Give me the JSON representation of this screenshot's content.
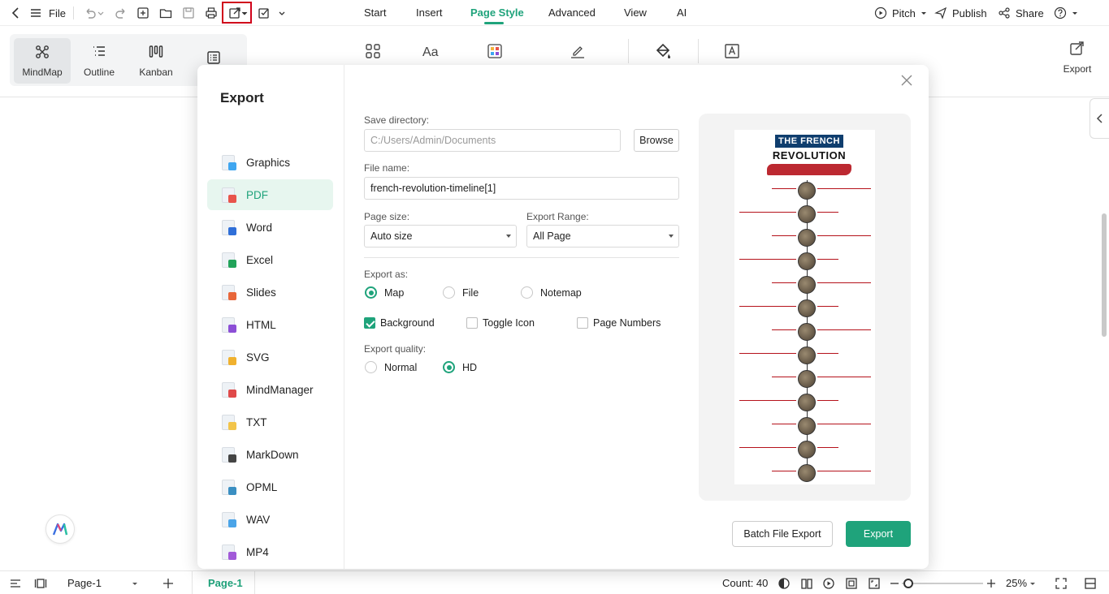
{
  "topbar": {
    "file_label": "File",
    "menu_tabs": [
      "Start",
      "Insert",
      "Page Style",
      "Advanced",
      "View",
      "AI"
    ],
    "active_tab": "Page Style",
    "pitch": "Pitch",
    "publish": "Publish",
    "share": "Share"
  },
  "ribbon": {
    "views": [
      "MindMap",
      "Outline",
      "Kanban"
    ],
    "export_label": "Export"
  },
  "export_dialog": {
    "title": "Export",
    "formats": [
      {
        "label": "Graphics",
        "color": "#3fa6f0"
      },
      {
        "label": "PDF",
        "color": "#e8544b"
      },
      {
        "label": "Word",
        "color": "#2f6fd8"
      },
      {
        "label": "Excel",
        "color": "#22a35a"
      },
      {
        "label": "Slides",
        "color": "#e8663a"
      },
      {
        "label": "HTML",
        "color": "#8c4fd6"
      },
      {
        "label": "SVG",
        "color": "#f0b12e"
      },
      {
        "label": "MindManager",
        "color": "#e04a4a"
      },
      {
        "label": "TXT",
        "color": "#f2c44a"
      },
      {
        "label": "MarkDown",
        "color": "#444444"
      },
      {
        "label": "OPML",
        "color": "#3a8fc2"
      },
      {
        "label": "WAV",
        "color": "#4aa4e8"
      },
      {
        "label": "MP4",
        "color": "#a15ad8"
      }
    ],
    "active_format": "PDF",
    "save_directory_label": "Save directory:",
    "save_directory_placeholder": "C:/Users/Admin/Documents",
    "browse": "Browse",
    "file_name_label": "File name:",
    "file_name": "french-revolution-timeline[1]",
    "page_size_label": "Page size:",
    "page_size": "Auto size",
    "export_range_label": "Export Range:",
    "export_range": "All Page",
    "export_as_label": "Export as:",
    "export_as_options": [
      "Map",
      "File",
      "Notemap"
    ],
    "export_as_selected": "Map",
    "checkboxes": [
      {
        "label": "Background",
        "checked": true
      },
      {
        "label": "Toggle Icon",
        "checked": false
      },
      {
        "label": "Page Numbers",
        "checked": false
      }
    ],
    "quality_label": "Export quality:",
    "quality_options": [
      "Normal",
      "HD"
    ],
    "quality_selected": "HD",
    "batch_button": "Batch File Export",
    "export_button": "Export",
    "preview": {
      "title_line1": "THE FRENCH",
      "title_line2": "REVOLUTION"
    }
  },
  "statusbar": {
    "page_select": "Page-1",
    "page_tab": "Page-1",
    "count": "Count: 40",
    "zoom": "25%"
  },
  "colors": {
    "accent": "#1fa37b",
    "highlight": "#d0021b"
  }
}
